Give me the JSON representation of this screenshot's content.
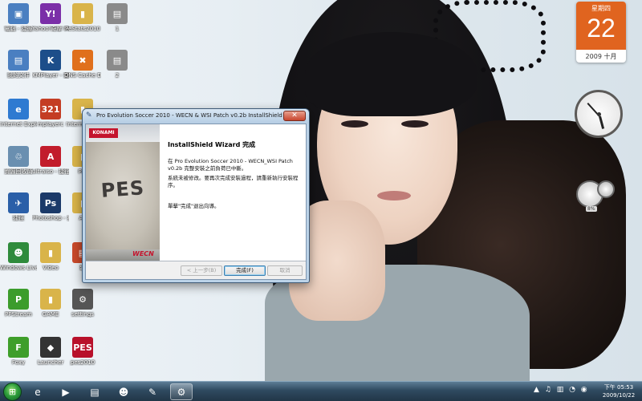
{
  "desktop_icons": [
    {
      "label": "電腦 - 捷徑",
      "glyph": "▣",
      "color": "#4a7fc1"
    },
    {
      "label": "Yahoo!奇摩 Messenger",
      "glyph": "Y!",
      "color": "#7b2fa8"
    },
    {
      "label": "PeStats2010",
      "glyph": "▮",
      "color": "#d9b44a"
    },
    {
      "label": "1",
      "glyph": "▤",
      "color": "#8a8a8a"
    },
    {
      "label": "我的文件",
      "glyph": "▤",
      "color": "#4a7fc1"
    },
    {
      "label": "KMPlayer - 捷徑",
      "glyph": "K",
      "color": "#1d4e8a"
    },
    {
      "label": "DNS Cache Del",
      "glyph": "✖",
      "color": "#e0701c"
    },
    {
      "label": "2",
      "glyph": "▤",
      "color": "#8a8a8a"
    },
    {
      "label": "Internet Explorer",
      "glyph": "e",
      "color": "#2e7ad1"
    },
    {
      "label": "mplayerc",
      "glyph": "321",
      "color": "#c43d24"
    },
    {
      "label": "Internet Pro",
      "glyph": "▮",
      "color": "#d9b44a"
    },
    {
      "label": "資源回收筒",
      "glyph": "♲",
      "color": "#6a8fb0"
    },
    {
      "label": "ultraiso - 捷徑",
      "glyph": "A",
      "color": "#c21d2c"
    },
    {
      "label": "Pro",
      "glyph": "▮",
      "color": "#d9b44a"
    },
    {
      "label": "捷徑",
      "glyph": "✈",
      "color": "#2a5fa8"
    },
    {
      "label": "Photoshop - 捷徑",
      "glyph": "Ps",
      "color": "#1b3a69"
    },
    {
      "label": "Ad",
      "glyph": "▮",
      "color": "#d9b44a"
    },
    {
      "label": "Windows Live Mes...",
      "glyph": "☻",
      "color": "#2f8b3c"
    },
    {
      "label": "Video",
      "glyph": "▮",
      "color": "#d9b44a"
    },
    {
      "label": "新",
      "glyph": "▤",
      "color": "#c94a2b"
    },
    {
      "label": "PPStream",
      "glyph": "P",
      "color": "#3c9c2c"
    },
    {
      "label": "GAME",
      "glyph": "▮",
      "color": "#d9b44a"
    },
    {
      "label": "settings",
      "glyph": "⚙",
      "color": "#555555"
    },
    {
      "label": "Foxy",
      "glyph": "F",
      "color": "#3e9e2a"
    },
    {
      "label": "Launcher",
      "glyph": "◆",
      "color": "#333333"
    },
    {
      "label": "pes2010",
      "glyph": "PES",
      "color": "#b8102a"
    }
  ],
  "calendar": {
    "weekday": "星期四",
    "day": "22",
    "month": "2009 十月"
  },
  "meter": {
    "label": "8%"
  },
  "dialog": {
    "title": "Pro Evolution Soccer 2010 - WECN & WSI Patch v0.2b InstallShield Wizard",
    "close_label": "✕",
    "heading": "InstallShield Wizard 完成",
    "paragraph1": "在 Pro Evolution Soccer 2010 - WECN_WSI Patch v0.2b 完整安裝之前負荷已中斷。",
    "paragraph2": "系統未被修改。要再次完成安裝過程，請重新執行安裝程序。",
    "paragraph3": "單擊\"完成\"退出向導。",
    "brand": "KONAMI",
    "pes_logo": "PES",
    "wecn": "WECN",
    "back_label": "< 上一步(B)",
    "finish_label": "完成(F)",
    "cancel_label": "取消"
  },
  "taskbar": {
    "start_glyph": "⊞",
    "pinned": [
      {
        "name": "ie-taskbar-icon",
        "glyph": "e",
        "active": false
      },
      {
        "name": "media-taskbar-icon",
        "glyph": "▶",
        "active": false
      },
      {
        "name": "explorer-taskbar-icon",
        "glyph": "▤",
        "active": false
      },
      {
        "name": "messenger-taskbar-icon",
        "glyph": "☻",
        "active": false
      },
      {
        "name": "wizard-taskbar-icon",
        "glyph": "✎",
        "active": false
      },
      {
        "name": "installer-taskbar-icon",
        "glyph": "⚙",
        "active": true
      }
    ],
    "tray_icons": "▲ ♫ ▥ ◔ ◉",
    "time": "下午 05:53",
    "date": "2009/10/22"
  }
}
